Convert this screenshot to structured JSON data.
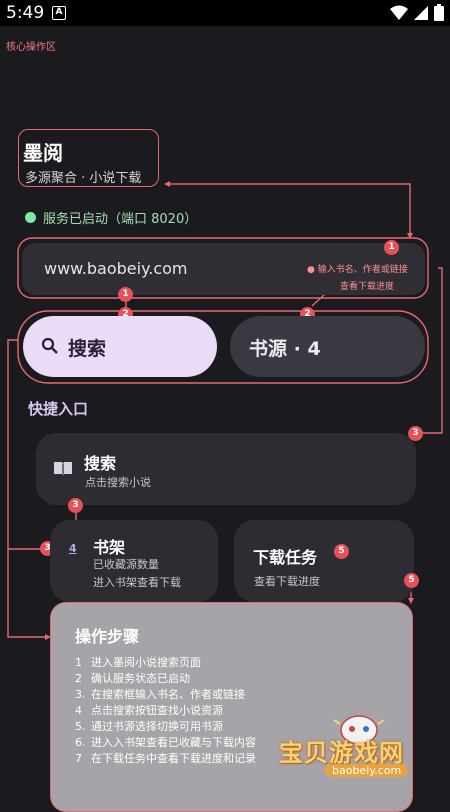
{
  "status_bar": {
    "time": "5:49",
    "notification_letter": "A",
    "icons": [
      "wifi-icon",
      "signal-icon",
      "battery-icon"
    ]
  },
  "core_label": "核心操作区",
  "app": {
    "title": "墨阅",
    "subtitle": "多源聚合 · 小说下载"
  },
  "service_status": "服务已启动（端口 8020）",
  "url_input": {
    "value": "www.baobeiy.com"
  },
  "annotations": {
    "input_hint": "输入书名、作者或链接",
    "download_hint": "查看下载进度"
  },
  "buttons": {
    "search_label": "搜索",
    "source_label": "书源 · 4"
  },
  "quick_entry": {
    "heading": "快捷入口",
    "search": {
      "title": "搜索",
      "subtitle": "点击搜索小说"
    },
    "bookshelf": {
      "title": "书架",
      "line1": "已收藏源数量",
      "line2": "进入书架查看下载",
      "count_icon": "4"
    },
    "downloads": {
      "title": "下载任务",
      "subtitle": "查看下载进度"
    }
  },
  "steps": {
    "title": "操作步骤",
    "items": [
      {
        "n": "1",
        "text": "进入墨阅小说搜索页面"
      },
      {
        "n": "2",
        "text": "确认服务状态已启动"
      },
      {
        "n": "3.",
        "text": "在搜索框输入书名、作者或链接"
      },
      {
        "n": "4",
        "text": "点击搜索按钮查找小说资源"
      },
      {
        "n": "5.",
        "text": "通过书源选择切换可用书源"
      },
      {
        "n": "6.",
        "text": "进入入书架查看已收藏与下载内容"
      },
      {
        "n": "7",
        "text": "在下载任务中查看下载进度和记录"
      }
    ]
  },
  "badges": {
    "b1": "1",
    "b2": "2",
    "b3": "3",
    "b5": "5"
  },
  "watermark": {
    "text": "宝贝游戏网",
    "url": "baobeiy.com"
  },
  "colors": {
    "background": "#1b1a1f",
    "annotation_red": "#e46a6e",
    "search_button": "#eadcf7",
    "status_green": "#7ee6a6"
  }
}
